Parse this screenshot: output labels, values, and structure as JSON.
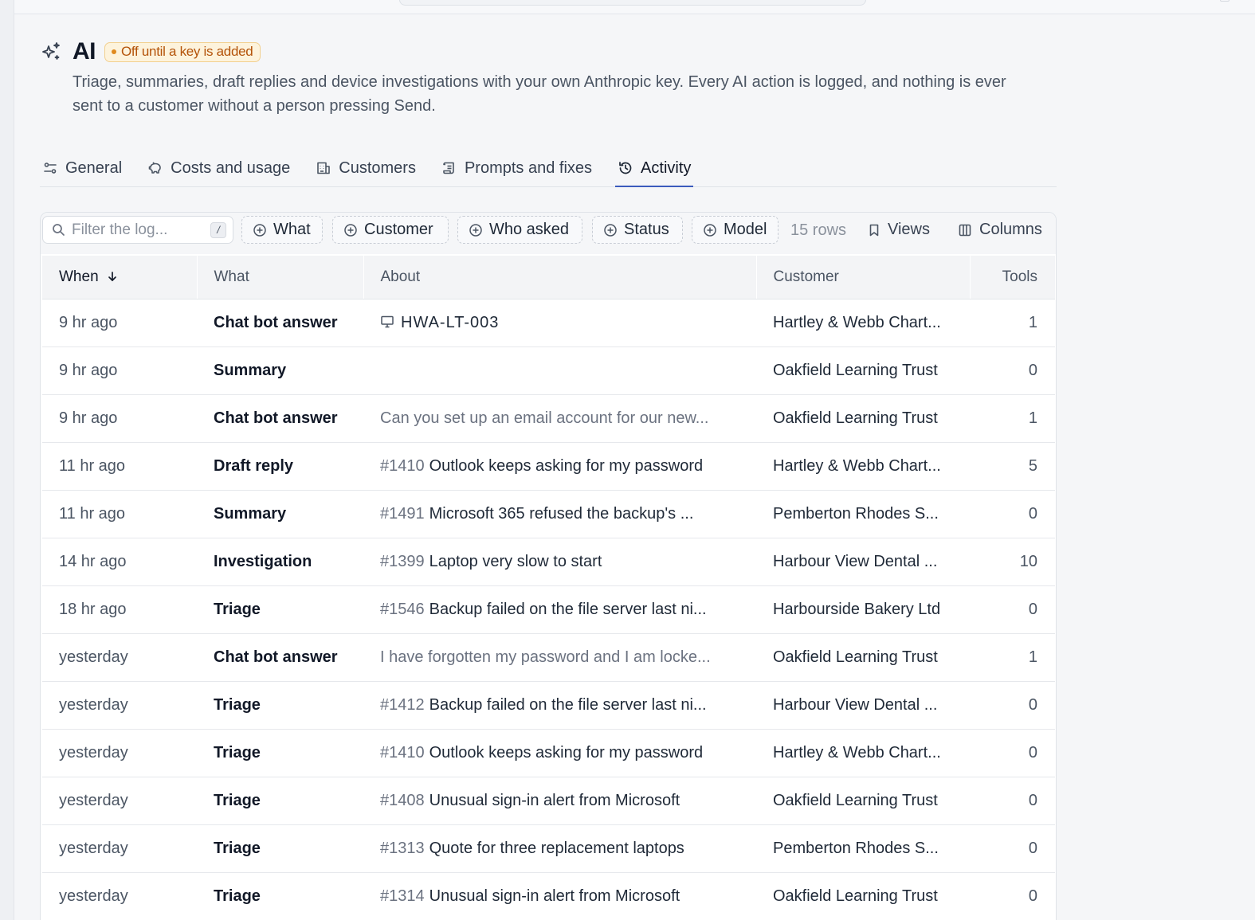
{
  "header": {
    "title": "AI",
    "badge": "Off until a key is added",
    "description": "Triage, summaries, draft replies and device investigations with your own Anthropic key. Every AI action is logged, and nothing is ever sent to a customer without a person pressing Send."
  },
  "tabs": [
    {
      "label": "General",
      "icon": "sliders-icon"
    },
    {
      "label": "Costs and usage",
      "icon": "piggy-bank-icon"
    },
    {
      "label": "Customers",
      "icon": "building-icon"
    },
    {
      "label": "Prompts and fixes",
      "icon": "scroll-icon"
    },
    {
      "label": "Activity",
      "icon": "history-icon",
      "active": true
    }
  ],
  "toolbar": {
    "filter_placeholder": "Filter the log...",
    "shortcut": "/",
    "chips": [
      "What",
      "Customer",
      "Who asked",
      "Status",
      "Model"
    ],
    "rows_count": "15 rows",
    "views_label": "Views",
    "columns_label": "Columns"
  },
  "table": {
    "columns": {
      "when": "When",
      "what": "What",
      "about": "About",
      "customer": "Customer",
      "tools": "Tools"
    },
    "sort_indicator": "arrow-down-icon",
    "rows": [
      {
        "when": "9 hr ago",
        "what": "Chat bot answer",
        "ref": "",
        "about": "HWA-LT-003",
        "about_kind": "device",
        "customer": "Hartley & Webb Chart...",
        "tools": "1"
      },
      {
        "when": "9 hr ago",
        "what": "Summary",
        "ref": "",
        "about": "",
        "about_kind": "none",
        "customer": "Oakfield Learning Trust",
        "tools": "0"
      },
      {
        "when": "9 hr ago",
        "what": "Chat bot answer",
        "ref": "",
        "about": "Can you set up an email account for our new...",
        "about_kind": "message",
        "customer": "Oakfield Learning Trust",
        "tools": "1"
      },
      {
        "when": "11 hr ago",
        "what": "Draft reply",
        "ref": "#1410",
        "about": "Outlook keeps asking for my password",
        "about_kind": "ticket",
        "customer": "Hartley & Webb Chart...",
        "tools": "5"
      },
      {
        "when": "11 hr ago",
        "what": "Summary",
        "ref": "#1491",
        "about": "Microsoft 365 refused the backup's ...",
        "about_kind": "ticket",
        "customer": "Pemberton Rhodes S...",
        "tools": "0"
      },
      {
        "when": "14 hr ago",
        "what": "Investigation",
        "ref": "#1399",
        "about": "Laptop very slow to start",
        "about_kind": "ticket",
        "customer": "Harbour View Dental ...",
        "tools": "10"
      },
      {
        "when": "18 hr ago",
        "what": "Triage",
        "ref": "#1546",
        "about": "Backup failed on the file server last ni...",
        "about_kind": "ticket",
        "customer": "Harbourside Bakery Ltd",
        "tools": "0"
      },
      {
        "when": "yesterday",
        "what": "Chat bot answer",
        "ref": "",
        "about": "I have forgotten my password and I am locke...",
        "about_kind": "message",
        "customer": "Oakfield Learning Trust",
        "tools": "1"
      },
      {
        "when": "yesterday",
        "what": "Triage",
        "ref": "#1412",
        "about": "Backup failed on the file server last ni...",
        "about_kind": "ticket",
        "customer": "Harbour View Dental ...",
        "tools": "0"
      },
      {
        "when": "yesterday",
        "what": "Triage",
        "ref": "#1410",
        "about": "Outlook keeps asking for my password",
        "about_kind": "ticket",
        "customer": "Hartley & Webb Chart...",
        "tools": "0"
      },
      {
        "when": "yesterday",
        "what": "Triage",
        "ref": "#1408",
        "about": "Unusual sign-in alert from Microsoft",
        "about_kind": "ticket",
        "customer": "Oakfield Learning Trust",
        "tools": "0"
      },
      {
        "when": "yesterday",
        "what": "Triage",
        "ref": "#1313",
        "about": "Quote for three replacement laptops",
        "about_kind": "ticket",
        "customer": "Pemberton Rhodes S...",
        "tools": "0"
      },
      {
        "when": "yesterday",
        "what": "Triage",
        "ref": "#1314",
        "about": "Unusual sign-in alert from Microsoft",
        "about_kind": "ticket",
        "customer": "Oakfield Learning Trust",
        "tools": "0"
      }
    ]
  },
  "colors": {
    "accent": "#3b5bbd",
    "badge_text": "#b45309",
    "badge_bg": "#fdf3dc"
  }
}
